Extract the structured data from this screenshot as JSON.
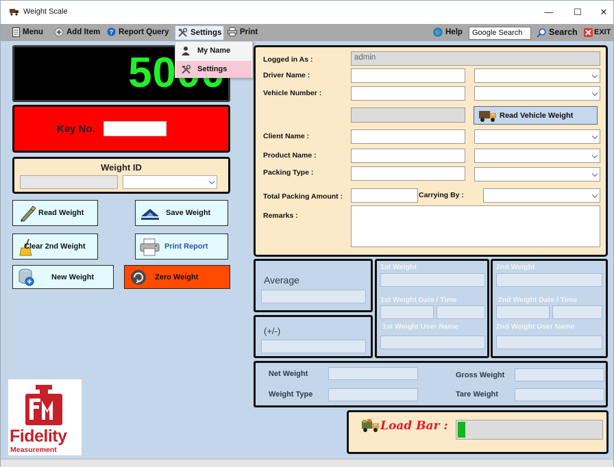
{
  "window": {
    "title": "Weight Scale",
    "minimize": "—",
    "maximize": "☐",
    "close": "✕"
  },
  "menu": {
    "menu": "Menu",
    "add_item": "Add Item",
    "report_query": "Report Query",
    "settings": "Settings",
    "print": "Print",
    "help": "Help",
    "search_box": "Google Search",
    "search": "Search",
    "exit": "EXIT"
  },
  "settings_dropdown": {
    "items": [
      "My Name",
      "Settings"
    ],
    "highlighted": "Settings"
  },
  "scale": {
    "reading": "5000",
    "reading_color": "#22ee2a"
  },
  "key": {
    "label": "Key No.",
    "value": ""
  },
  "weight_id": {
    "label": "Weight ID",
    "value": "",
    "selected": ""
  },
  "buttons": {
    "read_weight": "Read Weight",
    "save_weight": "Save Weight",
    "clear_2nd_weight": "Clear 2nd Weight",
    "print_report": "Print Report",
    "new_weight": "New Weight",
    "zero_weight": "Zero Weight",
    "read_vehicle_weight": "Read Vehicle Weight"
  },
  "form": {
    "logged_in_label": "Logged in As  :",
    "logged_in_value": "admin",
    "driver_name": "Driver Name :",
    "vehicle_number": "Vehicle Number :",
    "client_name": "Client Name :",
    "product_name": "Product Name :",
    "packing_type": "Packing Type :",
    "total_packing_amount": "Total Packing Amount :",
    "carrying_by": "Carrying By :",
    "remarks": "Remarks :"
  },
  "average": {
    "label": "Average",
    "plusminus": "(+/-)"
  },
  "first_weight": {
    "weight": "1st Weight",
    "date_time": "1st Weight Date   /   Time",
    "user": "1st Weight User Name"
  },
  "second_weight": {
    "weight": "2nd Weight",
    "date_time": "2nd Weight Date   /   Time",
    "user": "2nd Weight User Name"
  },
  "summary": {
    "net_weight": "Net Weight",
    "gross_weight": "Gross Weight",
    "weight_type": "Weight Type",
    "tare_weight": "Tare Weight"
  },
  "load_bar": {
    "label": "Load Bar :",
    "progress": 0.05,
    "color": "#12b51a"
  },
  "logo": {
    "monogram": "FM",
    "name": "Fidelity",
    "tagline": "Measurement"
  },
  "colors": {
    "panel_bg": "#c4d6ea",
    "form_bg": "#fce9c8",
    "key_bg": "#ff0000",
    "zero_btn": "#ff4a00",
    "btn_bg": "#e3fbff",
    "brand_red": "#c8202a"
  }
}
